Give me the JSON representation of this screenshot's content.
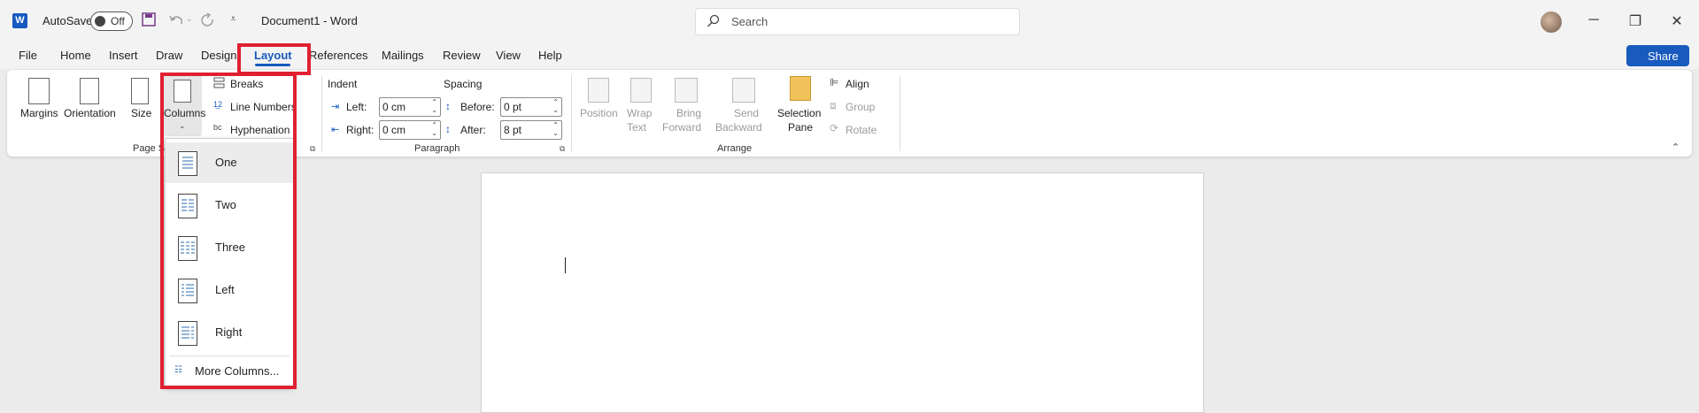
{
  "titlebar": {
    "autosave_label": "AutoSave",
    "autosave_state": "Off",
    "doc_title": "Document1  -  Word",
    "search_placeholder": "Search",
    "minimize": "─",
    "restore": "❐",
    "close": "✕"
  },
  "menu": {
    "tabs": [
      "File",
      "Home",
      "Insert",
      "Draw",
      "Design",
      "Layout",
      "References",
      "Mailings",
      "Review",
      "View",
      "Help"
    ],
    "active": "Layout",
    "share": "Share"
  },
  "ribbon": {
    "page_setup": {
      "margins": "Margins",
      "orientation": "Orientation",
      "size": "Size",
      "columns": "Columns",
      "breaks": "Breaks",
      "line_numbers": "Line Numbers",
      "hyphenation": "Hyphenation",
      "group_label": "Page S"
    },
    "paragraph": {
      "indent_label": "Indent",
      "spacing_label": "Spacing",
      "left_label": "Left:",
      "left_value": "0 cm",
      "right_label": "Right:",
      "right_value": "0 cm",
      "before_label": "Before:",
      "before_value": "0 pt",
      "after_label": "After:",
      "after_value": "8 pt",
      "group_label": "Paragraph"
    },
    "arrange": {
      "position": "Position",
      "wrap_text_1": "Wrap",
      "wrap_text_2": "Text",
      "bring_forward_1": "Bring",
      "bring_forward_2": "Forward",
      "send_backward_1": "Send",
      "send_backward_2": "Backward",
      "selection_pane_1": "Selection",
      "selection_pane_2": "Pane",
      "align": "Align",
      "group": "Group",
      "rotate": "Rotate",
      "group_label": "Arrange"
    }
  },
  "columns_menu": {
    "items": [
      "One",
      "Two",
      "Three",
      "Left",
      "Right"
    ],
    "selected": "One",
    "more": "More Columns..."
  },
  "colors": {
    "accent": "#185abd",
    "highlight": "#e02030"
  }
}
